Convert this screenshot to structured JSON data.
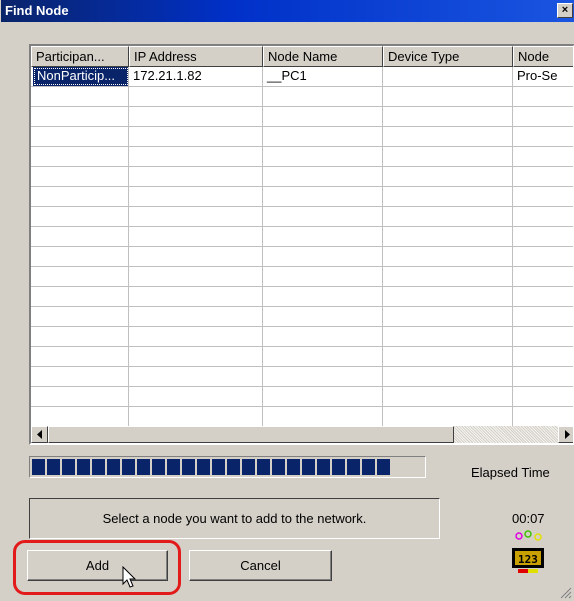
{
  "window": {
    "title": "Find Node",
    "close_glyph": "×"
  },
  "list": {
    "columns": [
      "Participan...",
      "IP Address",
      "Node Name",
      "Device Type",
      "Node"
    ],
    "rows": [
      [
        "NonParticip...",
        "172.21.1.82",
        "__PC1",
        "",
        "Pro-Se"
      ]
    ],
    "empty_rows": 17
  },
  "progress": {
    "blocks": 24,
    "fill_fraction": 1.0
  },
  "elapsed": {
    "label": "Elapsed Time",
    "value": "00:07"
  },
  "status": {
    "message": "Select a node you want to add to the network."
  },
  "buttons": {
    "add": "Add",
    "cancel": "Cancel"
  },
  "colors": {
    "title_bar": "#0a246a",
    "selection": "#0a246a",
    "highlight": "#e21a1a",
    "progress": "#0a246a"
  },
  "icons": {
    "cursor": "arrow-cursor-icon",
    "search_anim": "search-animation-icon",
    "grip": "resize-grip-icon"
  }
}
